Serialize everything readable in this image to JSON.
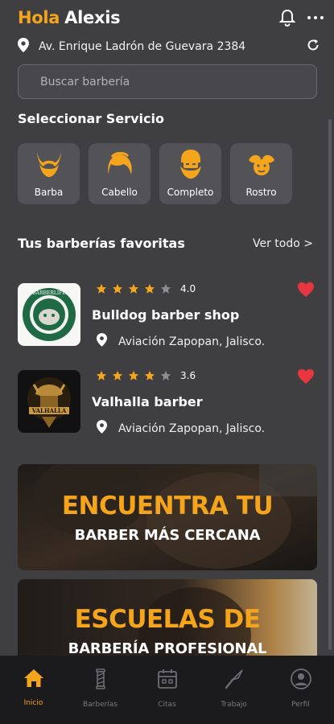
{
  "header": {
    "hello": "Hola",
    "user": "Alexis"
  },
  "location": {
    "address": "Av. Enrique Ladrón de Guevara 2384"
  },
  "search": {
    "placeholder": "Buscar barbería"
  },
  "services": {
    "title": "Seleccionar Servicio",
    "items": [
      {
        "label": "Barba",
        "icon": "beard-icon"
      },
      {
        "label": "Cabello",
        "icon": "hair-icon"
      },
      {
        "label": "Completo",
        "icon": "full-face-icon"
      },
      {
        "label": "Rostro",
        "icon": "face-leaf-icon"
      }
    ]
  },
  "favorites": {
    "title": "Tus barberías favoritas",
    "see_all": "Ver todo >",
    "shops": [
      {
        "name": "Bulldog barber shop",
        "rating": "4.0",
        "stars": 4,
        "location": "Aviación Zapopan, Jalisco.",
        "logo_text": "BARBERLIFE"
      },
      {
        "name": "Valhalla barber",
        "rating": "3.6",
        "stars": 4,
        "location": "Aviación Zapopan, Jalisco.",
        "logo_text": "VALHALLA"
      }
    ]
  },
  "banners": [
    {
      "line1": "ENCUENTRA TU",
      "line2": "BARBER MÁS CERCANA"
    },
    {
      "line1": "ESCUELAS DE",
      "line2": "BARBERÍA PROFESIONAL"
    }
  ],
  "tabs": [
    {
      "label": "Inicio",
      "icon": "home-icon",
      "active": true
    },
    {
      "label": "Barberías",
      "icon": "barber-pole-icon",
      "active": false
    },
    {
      "label": "Citas",
      "icon": "calendar-icon",
      "active": false
    },
    {
      "label": "Trabajo",
      "icon": "razor-icon",
      "active": false
    },
    {
      "label": "Perfil",
      "icon": "user-icon",
      "active": false
    }
  ],
  "colors": {
    "accent": "#f4a51c",
    "background": "#3f3f42",
    "card": "#535357",
    "heart": "#e8363f",
    "tabbar": "#1b1b1d"
  }
}
